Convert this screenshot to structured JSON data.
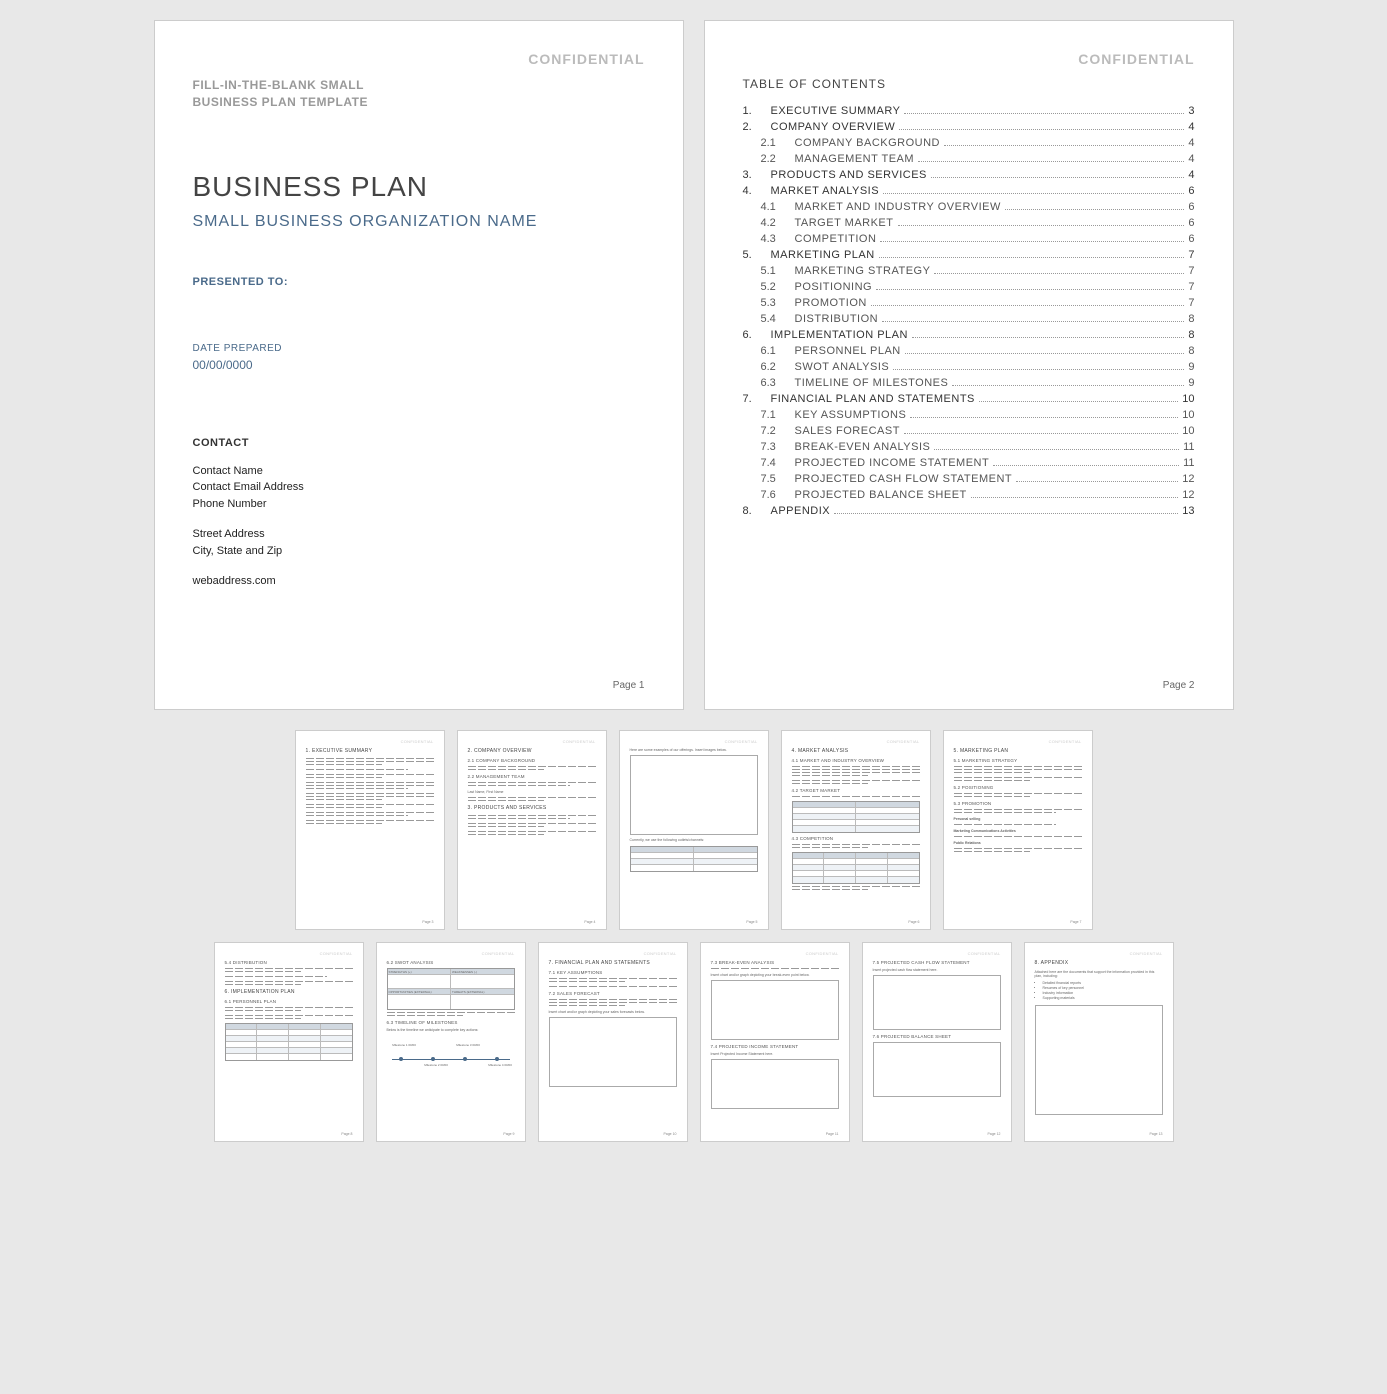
{
  "confidential": "CONFIDENTIAL",
  "page1": {
    "template_label_line1": "FILL-IN-THE-BLANK SMALL",
    "template_label_line2": "BUSINESS PLAN TEMPLATE",
    "title": "BUSINESS PLAN",
    "org_name": "SMALL BUSINESS ORGANIZATION NAME",
    "presented_to": "PRESENTED TO:",
    "date_label": "DATE PREPARED",
    "date_value": "00/00/0000",
    "contact_heading": "CONTACT",
    "contact": {
      "name": "Contact Name",
      "email": "Contact Email Address",
      "phone": "Phone Number",
      "street": "Street Address",
      "city": "City, State and Zip",
      "web": "webaddress.com"
    },
    "page_num": "Page 1"
  },
  "page2": {
    "toc_heading": "TABLE OF CONTENTS",
    "page_num": "Page 2",
    "toc": [
      {
        "num": "1.",
        "label": "EXECUTIVE SUMMARY",
        "page": "3",
        "level": 0
      },
      {
        "num": "2.",
        "label": "COMPANY OVERVIEW",
        "page": "4",
        "level": 0
      },
      {
        "num": "2.1",
        "label": "COMPANY BACKGROUND",
        "page": "4",
        "level": 1
      },
      {
        "num": "2.2",
        "label": "MANAGEMENT TEAM",
        "page": "4",
        "level": 1
      },
      {
        "num": "3.",
        "label": "PRODUCTS AND SERVICES",
        "page": "4",
        "level": 0
      },
      {
        "num": "4.",
        "label": "MARKET ANALYSIS",
        "page": "6",
        "level": 0
      },
      {
        "num": "4.1",
        "label": "MARKET AND INDUSTRY OVERVIEW",
        "page": "6",
        "level": 1
      },
      {
        "num": "4.2",
        "label": "TARGET MARKET",
        "page": "6",
        "level": 1
      },
      {
        "num": "4.3",
        "label": "COMPETITION",
        "page": "6",
        "level": 1
      },
      {
        "num": "5.",
        "label": "MARKETING PLAN",
        "page": "7",
        "level": 0
      },
      {
        "num": "5.1",
        "label": "MARKETING STRATEGY",
        "page": "7",
        "level": 1
      },
      {
        "num": "5.2",
        "label": "POSITIONING",
        "page": "7",
        "level": 1
      },
      {
        "num": "5.3",
        "label": "PROMOTION",
        "page": "7",
        "level": 1
      },
      {
        "num": "5.4",
        "label": "DISTRIBUTION",
        "page": "8",
        "level": 1
      },
      {
        "num": "6.",
        "label": "IMPLEMENTATION PLAN",
        "page": "8",
        "level": 0
      },
      {
        "num": "6.1",
        "label": "PERSONNEL PLAN",
        "page": "8",
        "level": 1
      },
      {
        "num": "6.2",
        "label": "SWOT ANALYSIS",
        "page": "9",
        "level": 1
      },
      {
        "num": "6.3",
        "label": "TIMELINE OF MILESTONES",
        "page": "9",
        "level": 1
      },
      {
        "num": "7.",
        "label": "FINANCIAL PLAN AND STATEMENTS",
        "page": "10",
        "level": 0
      },
      {
        "num": "7.1",
        "label": "KEY ASSUMPTIONS",
        "page": "10",
        "level": 1
      },
      {
        "num": "7.2",
        "label": "SALES FORECAST",
        "page": "10",
        "level": 1
      },
      {
        "num": "7.3",
        "label": "BREAK-EVEN ANALYSIS",
        "page": "11",
        "level": 1
      },
      {
        "num": "7.4",
        "label": "PROJECTED INCOME STATEMENT",
        "page": "11",
        "level": 1
      },
      {
        "num": "7.5",
        "label": "PROJECTED CASH FLOW STATEMENT",
        "page": "12",
        "level": 1
      },
      {
        "num": "7.6",
        "label": "PROJECTED BALANCE SHEET",
        "page": "12",
        "level": 1
      },
      {
        "num": "8.",
        "label": "APPENDIX",
        "page": "13",
        "level": 0
      }
    ]
  },
  "thumbs_row1": [
    {
      "heading": "1.  EXECUTIVE SUMMARY",
      "page": "Page 3"
    },
    {
      "heading": "2.  COMPANY OVERVIEW",
      "sub1": "2.1   COMPANY BACKGROUND",
      "sub2": "2.2   MANAGEMENT TEAM",
      "sub3": "3.  PRODUCTS AND SERVICES",
      "page": "Page 4"
    },
    {
      "heading": "",
      "note": "Here are some examples of our offerings. Insert images below.",
      "page": "Page 5"
    },
    {
      "heading": "4.  MARKET ANALYSIS",
      "sub1": "4.1   MARKET AND INDUSTRY OVERVIEW",
      "sub2": "4.2   TARGET MARKET",
      "sub3": "4.3   COMPETITION",
      "page": "Page 6"
    },
    {
      "heading": "5.  MARKETING PLAN",
      "sub1": "5.1   MARKETING STRATEGY",
      "sub2": "5.2   POSITIONING",
      "sub3": "5.3   PROMOTION",
      "page": "Page 7"
    }
  ],
  "thumbs_row2": [
    {
      "heading": "",
      "sub1": "5.4   DISTRIBUTION",
      "sub2": "6.  IMPLEMENTATION PLAN",
      "sub3": "6.1   PERSONNEL PLAN",
      "page": "Page 8"
    },
    {
      "heading": "",
      "sub1": "6.2   SWOT ANALYSIS",
      "sub2": "6.3   TIMELINE OF MILESTONES",
      "page": "Page 9",
      "swot": {
        "r1c1": "STRENGTHS (+)",
        "r1c2": "WEAKNESSES (-)",
        "r2c1": "OPPORTUNITIES (EXTERNAL)",
        "r2c2": "THREATS (EXTERNAL)"
      },
      "milestones": [
        "Milestone 1 00/00",
        "Milestone 2 00/00",
        "Milestone 3 00/00",
        "Milestone 4 00/00"
      ]
    },
    {
      "heading": "7.  FINANCIAL PLAN AND STATEMENTS",
      "sub1": "7.1   KEY ASSUMPTIONS",
      "sub2": "7.2   SALES FORECAST",
      "page": "Page 10"
    },
    {
      "heading": "",
      "sub1": "7.3   BREAK-EVEN ANALYSIS",
      "sub2": "7.4   PROJECTED INCOME STATEMENT",
      "page": "Page 11"
    },
    {
      "heading": "",
      "sub1": "7.5   PROJECTED CASH FLOW STATEMENT",
      "sub2": "7.6   PROJECTED BALANCE SHEET",
      "page": "Page 12"
    },
    {
      "heading": "8.  APPENDIX",
      "bullets": [
        "Detailed financial reports",
        "Resumes of key personnel",
        "Industry information",
        "Supporting materials"
      ],
      "page": "Page 13"
    }
  ]
}
